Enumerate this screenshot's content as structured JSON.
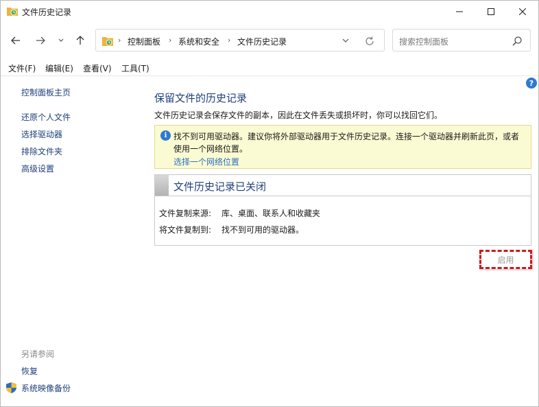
{
  "window": {
    "title": "文件历史记录"
  },
  "navbar": {
    "breadcrumbs": [
      "控制面板",
      "系统和安全",
      "文件历史记录"
    ],
    "search_placeholder": "搜索控制面板"
  },
  "menu": {
    "items": [
      "文件(F)",
      "编辑(E)",
      "查看(V)",
      "工具(T)"
    ]
  },
  "sidebar": {
    "home": "控制面板主页",
    "links": [
      "还原个人文件",
      "选择驱动器",
      "排除文件夹",
      "高级设置"
    ],
    "see_also_title": "另请参阅",
    "see_also": [
      "恢复",
      "系统映像备份"
    ]
  },
  "main": {
    "title": "保留文件的历史记录",
    "description": "文件历史记录会保存文件的副本，因此在文件丢失或损坏时，你可以找回它们。",
    "info": {
      "line1": "找不到可用驱动器。建议你将外部驱动器用于文件历史记录。连接一个驱动器并刷新此页，或者",
      "line2": "使用一个网络位置。",
      "link": "选择一个网络位置"
    },
    "status": {
      "title": "文件历史记录已关闭",
      "copy_from_label": "文件复制来源:",
      "copy_from_value": "库、桌面、联系人和收藏夹",
      "copy_to_label": "将文件复制到:",
      "copy_to_value": "找不到可用的驱动器。"
    },
    "enable_button": "启用"
  },
  "colors": {
    "link": "#1e3f7a",
    "info_bg": "#fbfbd3",
    "highlight": "#d01818"
  }
}
